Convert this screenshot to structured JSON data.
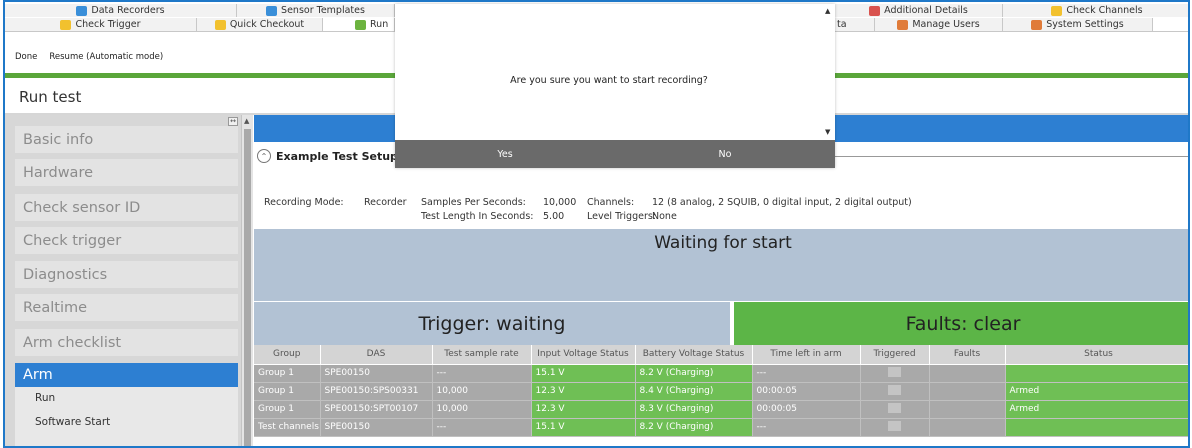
{
  "tabs_row1": [
    {
      "label": "Data Recorders",
      "icon": "data-recorders-icon"
    },
    {
      "label": "Sensor Templates",
      "icon": "sensor-templates-icon"
    },
    {
      "label": "Additional Details",
      "icon": "additional-details-icon"
    },
    {
      "label": "Check Channels",
      "icon": "check-channels-icon"
    }
  ],
  "tabs_row2": [
    {
      "label": "Check Trigger",
      "icon": "check-trigger-icon"
    },
    {
      "label": "Quick Checkout",
      "icon": "quick-checkout-icon"
    },
    {
      "label": "Run",
      "icon": "run-icon"
    },
    {
      "label": "ta",
      "icon": ""
    },
    {
      "label": "Manage Users",
      "icon": "manage-users-icon"
    },
    {
      "label": "System Settings",
      "icon": "system-settings-icon"
    }
  ],
  "toolbar": {
    "done": "Done",
    "resume": "Resume (Automatic mode)"
  },
  "page_title": "Run test",
  "sidebar": {
    "items": [
      "Basic info",
      "Hardware",
      "Check sensor ID",
      "Check trigger",
      "Diagnostics",
      "Realtime",
      "Arm checklist",
      "Arm"
    ],
    "subitems": [
      "Run",
      "Software Start"
    ]
  },
  "setup": {
    "title": "Example Test Setup",
    "recording_mode_label": "Recording Mode:",
    "recording_mode_value": "Recorder",
    "sps_label": "Samples Per Seconds:",
    "sps_value": "10,000",
    "test_length_label": "Test Length In Seconds:",
    "test_length_value": "5.00",
    "channels_label": "Channels:",
    "channels_value": "12 (8  analog, 2 SQUIB, 0 digital input, 2 digital output)",
    "level_triggers_label": "Level Triggers:",
    "level_triggers_value": "None"
  },
  "status": {
    "waiting": "Waiting for start",
    "trigger": "Trigger: waiting",
    "faults": "Faults: clear"
  },
  "table": {
    "headers": [
      "Group",
      "DAS",
      "Test sample rate",
      "Input Voltage Status",
      "Battery Voltage Status",
      "Time left in arm",
      "Triggered",
      "Faults",
      "Status"
    ],
    "rows": [
      [
        "Group 1",
        "SPE00150",
        "---",
        "15.1 V",
        "8.2 V (Charging)",
        "---",
        "",
        "",
        ""
      ],
      [
        "Group 1",
        "SPE00150:SPS00331",
        "10,000",
        "12.3 V",
        "8.4 V (Charging)",
        "00:00:05",
        "",
        "",
        "Armed"
      ],
      [
        "Group 1",
        "SPE00150:SPT00107",
        "10,000",
        "12.3 V",
        "8.3 V (Charging)",
        "00:00:05",
        "",
        "",
        "Armed"
      ],
      [
        "Test channels",
        "SPE00150",
        "---",
        "15.1 V",
        "8.2 V (Charging)",
        "---",
        "",
        "",
        ""
      ]
    ]
  },
  "dialog": {
    "message": "Are you sure you want to start recording?",
    "yes": "Yes",
    "no": "No"
  }
}
